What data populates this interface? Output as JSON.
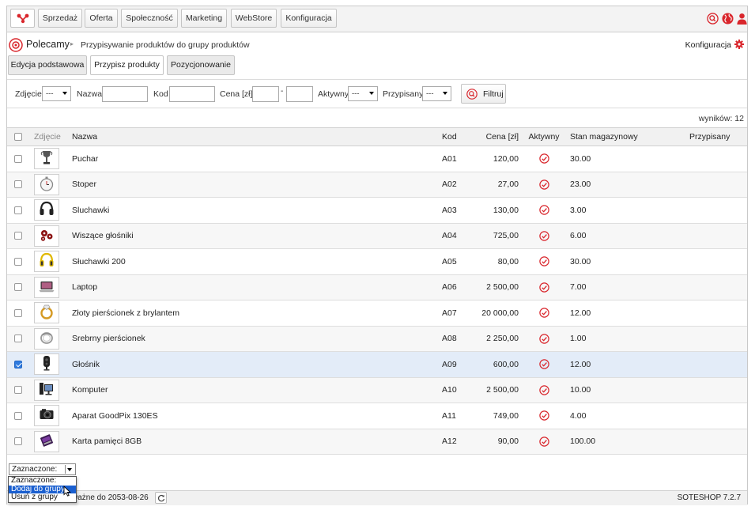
{
  "topbar": {
    "nav": [
      "Sprzedaż",
      "Oferta",
      "Społeczność",
      "Marketing",
      "WebStore",
      "Konfiguracja"
    ],
    "icons": [
      "search-icon",
      "globe-icon",
      "user-icon"
    ]
  },
  "breadcrumb": {
    "root": "Polecamy",
    "separator": "▸",
    "page": "Przypisywanie produktów do grupy produktów",
    "config_link": "Konfiguracja"
  },
  "tabs": [
    "Edycja podstawowa",
    "Przypisz produkty",
    "Pozycjonowanie"
  ],
  "active_tab": 1,
  "filter": {
    "photo_label": "Zdjęcie",
    "photo_value": "---",
    "name_label": "Nazwa",
    "code_label": "Kod",
    "price_label": "Cena [zł]",
    "price_dash": "-",
    "active_label": "Aktywny",
    "active_value": "---",
    "assigned_label": "Przypisany",
    "assigned_value": "---",
    "filter_button": "Filtruj"
  },
  "results_text": "wyników: 12",
  "table": {
    "headers": [
      "Zdjęcie",
      "Nazwa",
      "Kod",
      "Cena [zł]",
      "Aktywny",
      "Stan magazynowy",
      "Przypisany"
    ],
    "rows": [
      {
        "name": "Puchar",
        "code": "A01",
        "price": "120,00",
        "stock": "30.00",
        "checked": false,
        "icon": "trophy"
      },
      {
        "name": "Stoper",
        "code": "A02",
        "price": "27,00",
        "stock": "23.00",
        "checked": false,
        "icon": "stopwatch"
      },
      {
        "name": "Sluchawki",
        "code": "A03",
        "price": "130,00",
        "stock": "3.00",
        "checked": false,
        "icon": "headphones"
      },
      {
        "name": "Wiszące głośniki",
        "code": "A04",
        "price": "725,00",
        "stock": "6.00",
        "checked": false,
        "icon": "speakers"
      },
      {
        "name": "Słuchawki 200",
        "code": "A05",
        "price": "80,00",
        "stock": "30.00",
        "checked": false,
        "icon": "headphones-yellow"
      },
      {
        "name": "Laptop",
        "code": "A06",
        "price": "2 500,00",
        "stock": "7.00",
        "checked": false,
        "icon": "laptop"
      },
      {
        "name": "Złoty pierścionek z brylantem",
        "code": "A07",
        "price": "20 000,00",
        "stock": "12.00",
        "checked": false,
        "icon": "gold-ring"
      },
      {
        "name": "Srebrny pierścionek",
        "code": "A08",
        "price": "2 250,00",
        "stock": "1.00",
        "checked": false,
        "icon": "silver-ring"
      },
      {
        "name": "Głośnik",
        "code": "A09",
        "price": "600,00",
        "stock": "12.00",
        "checked": true,
        "icon": "speaker"
      },
      {
        "name": "Komputer",
        "code": "A10",
        "price": "2 500,00",
        "stock": "10.00",
        "checked": false,
        "icon": "computer"
      },
      {
        "name": "Aparat GoodPix 130ES",
        "code": "A11",
        "price": "749,00",
        "stock": "4.00",
        "checked": false,
        "icon": "camera"
      },
      {
        "name": "Karta pamięci 8GB",
        "code": "A12",
        "price": "90,00",
        "stock": "100.00",
        "checked": false,
        "icon": "memory-card"
      }
    ]
  },
  "bulk": {
    "selected": "Zaznaczone:",
    "options": [
      "Zaznaczone:",
      "Dodaj do grupy",
      "Usuń z grupy"
    ],
    "highlighted": 1
  },
  "footer": {
    "license": "ważne do 2053-08-26",
    "version": "SOTESHOP 7.2.7"
  },
  "colors": {
    "brand": "#d9262c",
    "selected_row": "#e3ecf8",
    "highlight": "#1a5fd0"
  }
}
